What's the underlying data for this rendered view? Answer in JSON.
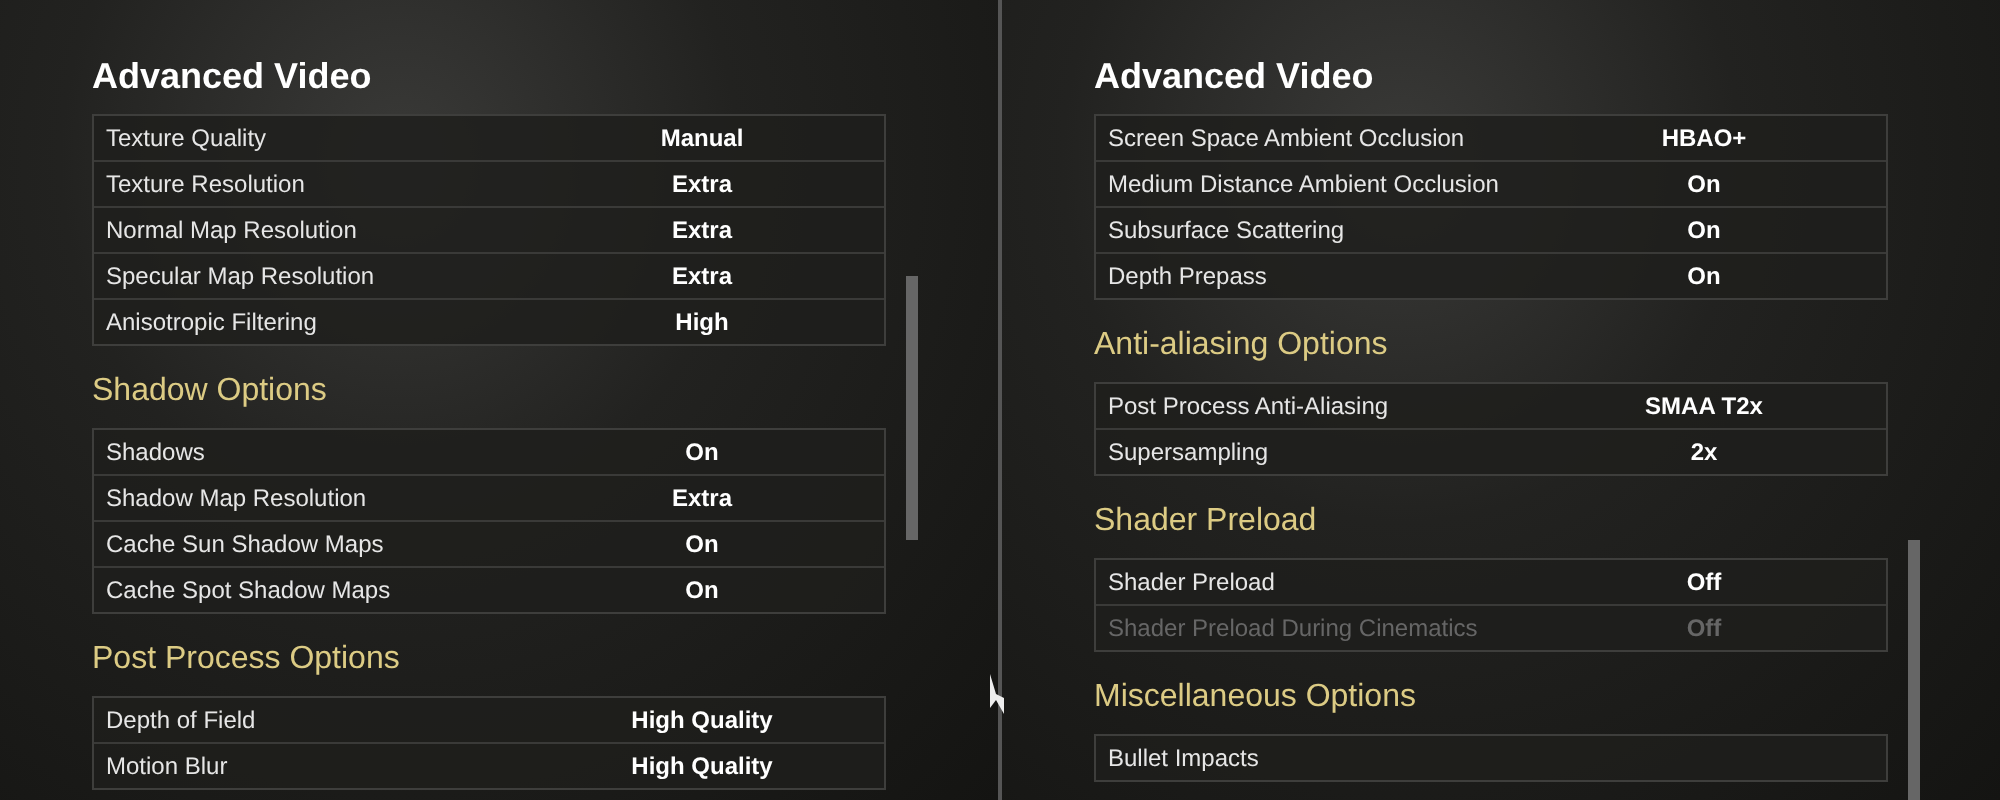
{
  "panels": [
    {
      "title": "Advanced Video",
      "sections": [
        {
          "rows": [
            {
              "label": "Texture Quality",
              "value": "Manual",
              "disabled": false
            },
            {
              "label": "Texture Resolution",
              "value": "Extra",
              "disabled": false
            },
            {
              "label": "Normal Map Resolution",
              "value": "Extra",
              "disabled": false
            },
            {
              "label": "Specular Map Resolution",
              "value": "Extra",
              "disabled": false
            },
            {
              "label": "Anisotropic Filtering",
              "value": "High",
              "disabled": false
            }
          ]
        },
        {
          "title": "Shadow Options",
          "rows": [
            {
              "label": "Shadows",
              "value": "On",
              "disabled": false
            },
            {
              "label": "Shadow Map Resolution",
              "value": "Extra",
              "disabled": false
            },
            {
              "label": "Cache Sun Shadow Maps",
              "value": "On",
              "disabled": false
            },
            {
              "label": "Cache Spot Shadow Maps",
              "value": "On",
              "disabled": false
            }
          ]
        },
        {
          "title": "Post Process Options",
          "rows": [
            {
              "label": "Depth of Field",
              "value": "High Quality",
              "disabled": false
            },
            {
              "label": "Motion Blur",
              "value": "High Quality",
              "disabled": false
            }
          ]
        }
      ]
    },
    {
      "title": "Advanced Video",
      "sections": [
        {
          "rows": [
            {
              "label": "Screen Space Ambient Occlusion",
              "value": "HBAO+",
              "disabled": false
            },
            {
              "label": "Medium Distance Ambient Occlusion",
              "value": "On",
              "disabled": false
            },
            {
              "label": "Subsurface Scattering",
              "value": "On",
              "disabled": false
            },
            {
              "label": "Depth Prepass",
              "value": "On",
              "disabled": false
            }
          ]
        },
        {
          "title": "Anti-aliasing Options",
          "rows": [
            {
              "label": "Post Process Anti-Aliasing",
              "value": "SMAA T2x",
              "disabled": false
            },
            {
              "label": "Supersampling",
              "value": "2x",
              "disabled": false
            }
          ]
        },
        {
          "title": "Shader Preload",
          "rows": [
            {
              "label": "Shader Preload",
              "value": "Off",
              "disabled": false
            },
            {
              "label": "Shader Preload During Cinematics",
              "value": "Off",
              "disabled": true
            }
          ]
        },
        {
          "title": "Miscellaneous Options",
          "rows": [
            {
              "label": "Bullet Impacts",
              "disabled": false
            }
          ]
        }
      ]
    }
  ]
}
